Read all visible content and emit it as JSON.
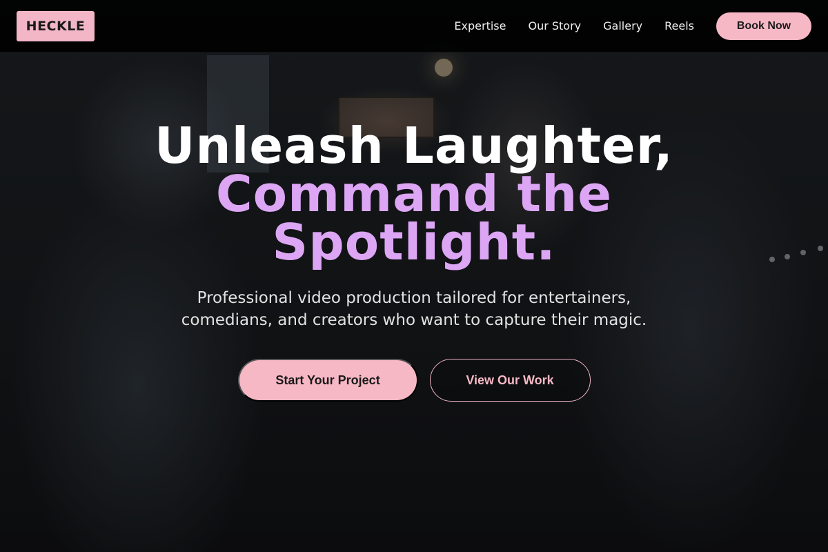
{
  "brand": {
    "logo_text": "HECKLE"
  },
  "nav": {
    "links": [
      "Expertise",
      "Our Story",
      "Gallery",
      "Reels"
    ],
    "cta_label": "Book Now"
  },
  "hero": {
    "headline_line1": "Unleash Laughter,",
    "headline_line2": "Command the Spotlight.",
    "subtitle": "Professional video production tailored for entertainers, comedians, and creators who want to capture their magic.",
    "primary_cta": "Start Your Project",
    "secondary_cta": "View Our Work"
  },
  "colors": {
    "accent_pink": "#f7b8c6",
    "accent_purple": "#dca6f4",
    "nav_background": "#000000"
  }
}
